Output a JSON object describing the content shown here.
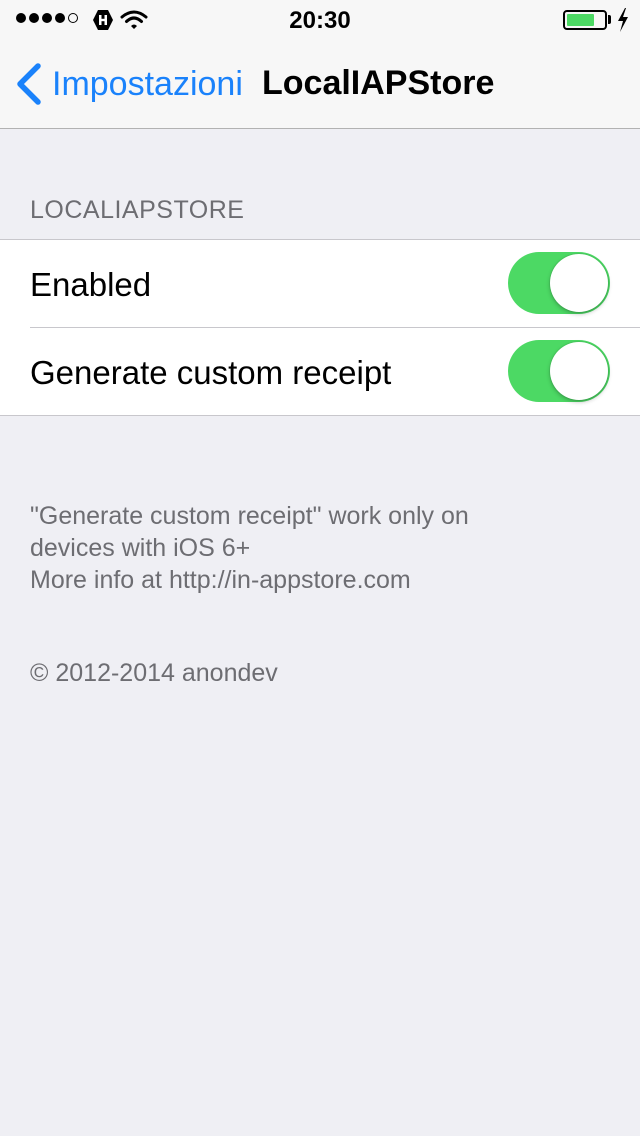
{
  "status_bar": {
    "signal_dots": [
      true,
      true,
      true,
      true,
      false
    ],
    "carrier_icon": "carrier-logo-icon",
    "wifi_icon": "wifi-icon",
    "time": "20:30",
    "battery_level": 0.75,
    "battery_color": "#4cd964",
    "charging_icon": "bolt-icon"
  },
  "nav": {
    "back_label": "Impostazioni",
    "title": "LocalIAPStore",
    "accent_color": "#1a82fb"
  },
  "section": {
    "header": "LOCALIAPSTORE",
    "cells": [
      {
        "label": "Enabled",
        "on": true
      },
      {
        "label": "Generate custom receipt",
        "on": true
      }
    ],
    "toggle_color": "#4cd964"
  },
  "footer": {
    "lines": [
      "\"Generate custom receipt\" work only on",
      "devices with iOS 6+",
      "More info at http://in-appstore.com"
    ],
    "copyright": "© 2012-2014 anondev"
  }
}
